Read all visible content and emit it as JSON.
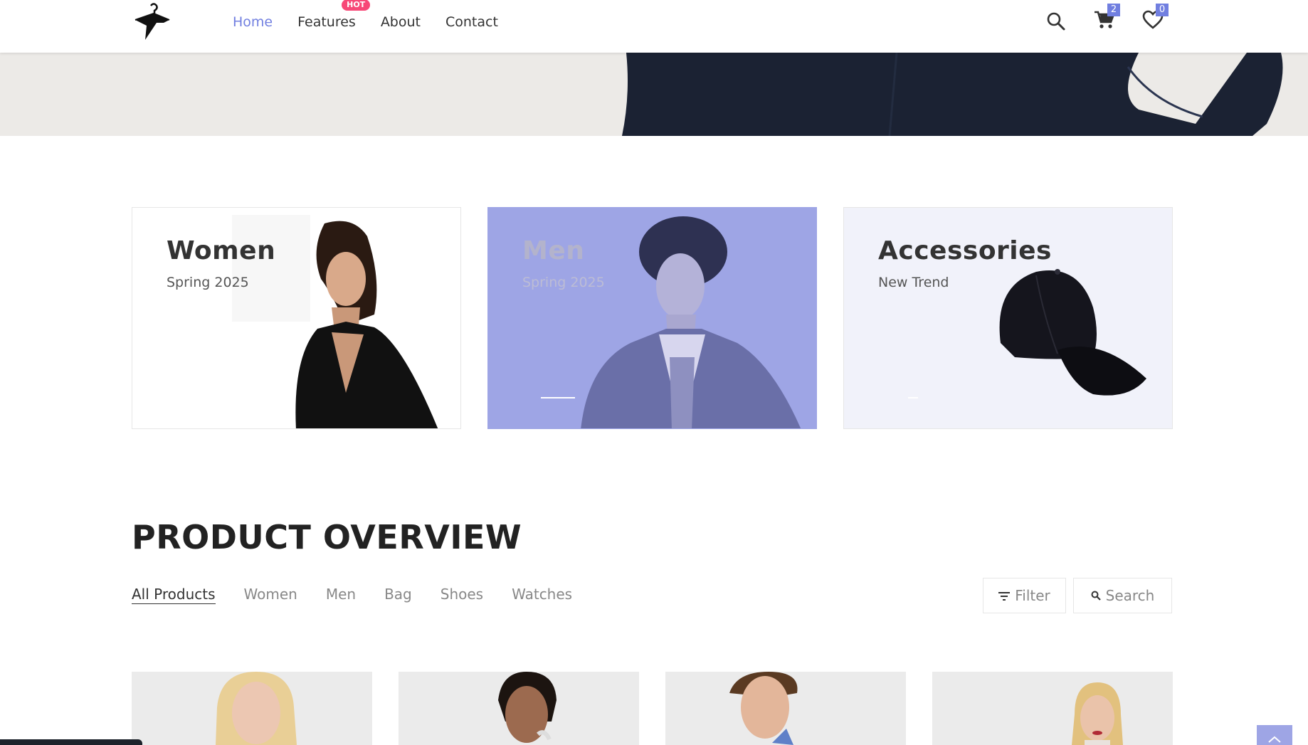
{
  "nav": {
    "items": [
      {
        "label": "Home",
        "active": true
      },
      {
        "label": "Features",
        "badge": "HOT"
      },
      {
        "label": "About"
      },
      {
        "label": "Contact"
      }
    ]
  },
  "header_icons": {
    "search": "search-icon",
    "cart": {
      "icon": "cart-icon",
      "count": "2"
    },
    "wishlist": {
      "icon": "heart-icon",
      "count": "0"
    }
  },
  "banners": [
    {
      "title": "Women",
      "subtitle": "Spring 2025"
    },
    {
      "title": "Men",
      "subtitle": "Spring 2025"
    },
    {
      "title": "Accessories",
      "subtitle": "New Trend"
    }
  ],
  "product_overview": {
    "title": "PRODUCT OVERVIEW",
    "filters": [
      {
        "label": "All Products",
        "active": true
      },
      {
        "label": "Women"
      },
      {
        "label": "Men"
      },
      {
        "label": "Bag"
      },
      {
        "label": "Shoes"
      },
      {
        "label": "Watches"
      }
    ],
    "filter_button": "Filter",
    "search_button": "Search"
  },
  "colors": {
    "accent": "#717fe0",
    "hot_badge": "#f74877",
    "men_overlay": "#9ea5e5",
    "accessories_bg": "#f1f2fa"
  }
}
